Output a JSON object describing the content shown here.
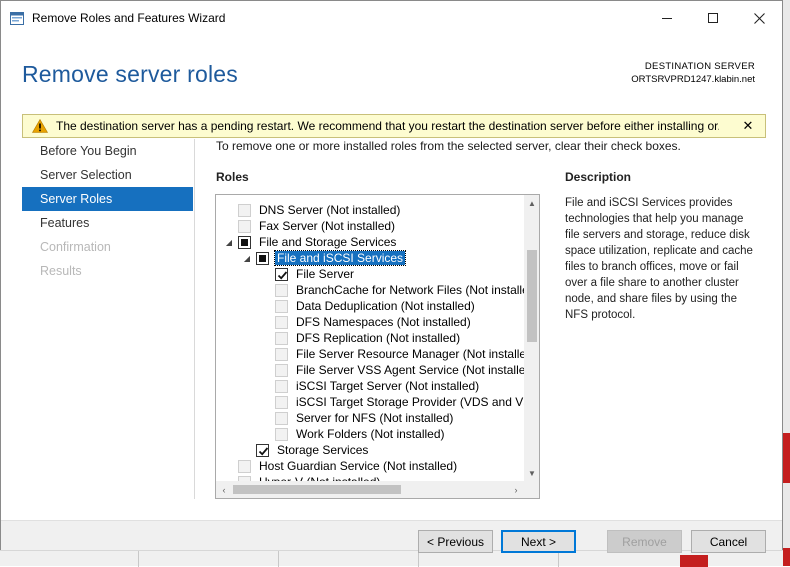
{
  "window": {
    "title": "Remove Roles and Features Wizard"
  },
  "header": {
    "page_title": "Remove server roles",
    "destination_label": "DESTINATION SERVER",
    "destination_server": "ORTSRVPRD1247.klabin.net"
  },
  "warning": {
    "text": "The destination server has a pending restart. We recommend that you restart the destination server before either installing or...",
    "close": "✕"
  },
  "nav": {
    "items": [
      {
        "label": "Before You Begin",
        "state": "normal"
      },
      {
        "label": "Server Selection",
        "state": "normal"
      },
      {
        "label": "Server Roles",
        "state": "active"
      },
      {
        "label": "Features",
        "state": "normal"
      },
      {
        "label": "Confirmation",
        "state": "disabled"
      },
      {
        "label": "Results",
        "state": "disabled"
      }
    ]
  },
  "main": {
    "instruction": "To remove one or more installed roles from the selected server, clear their check boxes.",
    "roles_label": "Roles",
    "description_label": "Description",
    "description_text": "File and iSCSI Services provides technologies that help you manage file servers and storage, reduce disk space utilization, replicate and cache files to branch offices, move or fail over a file share to another cluster node, and share files by using the NFS protocol.",
    "roles": [
      {
        "label": "DNS Server (Not installed)",
        "level": 0,
        "state": "disabled",
        "expander": "none"
      },
      {
        "label": "Fax Server (Not installed)",
        "level": 0,
        "state": "disabled",
        "expander": "none"
      },
      {
        "label": "File and Storage Services",
        "level": 0,
        "state": "indeterminate",
        "expander": "open"
      },
      {
        "label": "File and iSCSI Services",
        "level": 1,
        "state": "indeterminate",
        "expander": "open",
        "selected": true
      },
      {
        "label": "File Server",
        "level": 2,
        "state": "checked",
        "expander": "none"
      },
      {
        "label": "BranchCache for Network Files (Not installed)",
        "level": 2,
        "state": "disabled",
        "expander": "none"
      },
      {
        "label": "Data Deduplication (Not installed)",
        "level": 2,
        "state": "disabled",
        "expander": "none"
      },
      {
        "label": "DFS Namespaces (Not installed)",
        "level": 2,
        "state": "disabled",
        "expander": "none"
      },
      {
        "label": "DFS Replication (Not installed)",
        "level": 2,
        "state": "disabled",
        "expander": "none"
      },
      {
        "label": "File Server Resource Manager (Not installed)",
        "level": 2,
        "state": "disabled",
        "expander": "none"
      },
      {
        "label": "File Server VSS Agent Service (Not installed)",
        "level": 2,
        "state": "disabled",
        "expander": "none"
      },
      {
        "label": "iSCSI Target Server (Not installed)",
        "level": 2,
        "state": "disabled",
        "expander": "none"
      },
      {
        "label": "iSCSI Target Storage Provider (VDS and VSS hardware providers) (Not installed)",
        "level": 2,
        "state": "disabled",
        "expander": "none"
      },
      {
        "label": "Server for NFS (Not installed)",
        "level": 2,
        "state": "disabled",
        "expander": "none"
      },
      {
        "label": "Work Folders (Not installed)",
        "level": 2,
        "state": "disabled",
        "expander": "none"
      },
      {
        "label": "Storage Services",
        "level": 1,
        "state": "checked",
        "expander": "none"
      },
      {
        "label": "Host Guardian Service (Not installed)",
        "level": 0,
        "state": "disabled",
        "expander": "none"
      },
      {
        "label": "Hyper-V (Not installed)",
        "level": 0,
        "state": "disabled",
        "expander": "none"
      }
    ]
  },
  "footer": {
    "previous": "< Previous",
    "next": "Next >",
    "remove": "Remove",
    "cancel": "Cancel"
  },
  "colors": {
    "accent": "#1670bf",
    "title_blue": "#1e5a9c",
    "warning_bg": "#fdfcd0",
    "warning_icon": "#e8a200"
  }
}
